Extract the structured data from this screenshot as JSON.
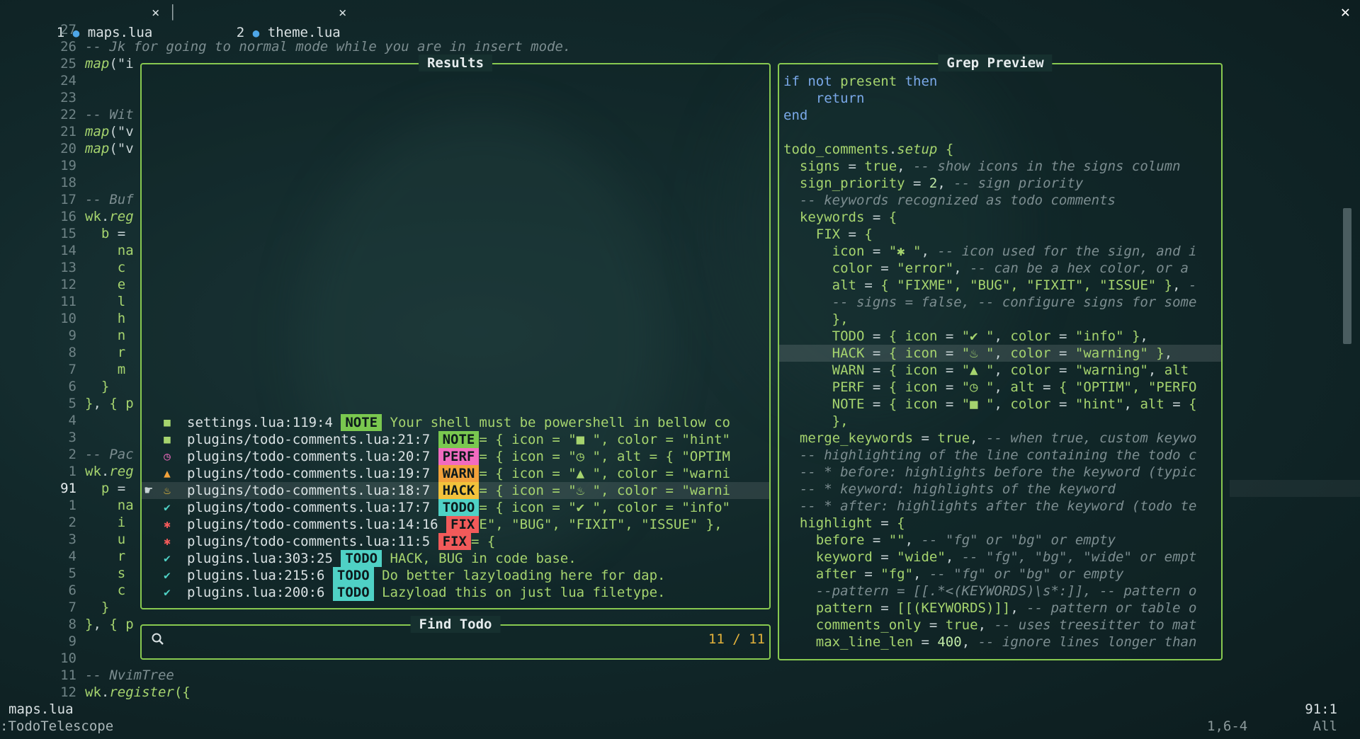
{
  "tabs": [
    {
      "index": "1",
      "name": "maps.lua",
      "close": "×"
    },
    {
      "index": "2",
      "name": "theme.lua",
      "close": "×"
    }
  ],
  "window_close": "✕",
  "editor": {
    "lines": [
      {
        "n": "27",
        "parts": []
      },
      {
        "n": "26",
        "parts": [
          [
            "cm",
            "-- Jk for going to normal mode while you are in insert mode."
          ]
        ]
      },
      {
        "n": "25",
        "parts": [
          [
            "fn",
            "map"
          ],
          [
            "op",
            "(\"i"
          ]
        ]
      },
      {
        "n": "24",
        "parts": []
      },
      {
        "n": "23",
        "parts": []
      },
      {
        "n": "22",
        "parts": [
          [
            "cm",
            "-- Wit"
          ]
        ]
      },
      {
        "n": "21",
        "parts": [
          [
            "fn",
            "map"
          ],
          [
            "op",
            "(\"v"
          ]
        ]
      },
      {
        "n": "20",
        "parts": [
          [
            "fn",
            "map"
          ],
          [
            "op",
            "(\"v"
          ]
        ]
      },
      {
        "n": "19",
        "parts": []
      },
      {
        "n": "18",
        "parts": []
      },
      {
        "n": "17",
        "parts": [
          [
            "cm",
            "-- Buf"
          ]
        ]
      },
      {
        "n": "16",
        "parts": [
          [
            "var",
            "wk"
          ],
          [
            "op",
            "."
          ],
          [
            "fn",
            "reg"
          ]
        ]
      },
      {
        "n": "15",
        "parts": [
          [
            "var",
            "  b "
          ],
          [
            "op",
            "="
          ]
        ]
      },
      {
        "n": "14",
        "parts": [
          [
            "var",
            "    na"
          ]
        ]
      },
      {
        "n": "13",
        "parts": [
          [
            "var",
            "    c"
          ]
        ]
      },
      {
        "n": "12",
        "parts": [
          [
            "var",
            "    e"
          ]
        ]
      },
      {
        "n": "11",
        "parts": [
          [
            "var",
            "    l"
          ]
        ]
      },
      {
        "n": "10",
        "parts": [
          [
            "var",
            "    h"
          ]
        ]
      },
      {
        "n": "9",
        "parts": [
          [
            "var",
            "    n"
          ]
        ]
      },
      {
        "n": "8",
        "parts": [
          [
            "var",
            "    r"
          ]
        ]
      },
      {
        "n": "7",
        "parts": [
          [
            "var",
            "    m"
          ]
        ]
      },
      {
        "n": "6",
        "parts": [
          [
            "str",
            "  }"
          ]
        ]
      },
      {
        "n": "5",
        "parts": [
          [
            "str",
            "}"
          ],
          [
            "op",
            ", "
          ],
          [
            "str",
            "{ p"
          ]
        ]
      },
      {
        "n": "4",
        "parts": []
      },
      {
        "n": "3",
        "parts": []
      },
      {
        "n": "2",
        "parts": [
          [
            "cm",
            "-- Pac"
          ]
        ]
      },
      {
        "n": "1",
        "parts": [
          [
            "var",
            "wk"
          ],
          [
            "op",
            "."
          ],
          [
            "fn",
            "reg"
          ]
        ]
      },
      {
        "n": "91",
        "cur": true,
        "parts": [
          [
            "var",
            "  p "
          ],
          [
            "op",
            "="
          ]
        ]
      },
      {
        "n": "1",
        "parts": [
          [
            "var",
            "    na"
          ]
        ]
      },
      {
        "n": "2",
        "parts": [
          [
            "var",
            "    i"
          ]
        ]
      },
      {
        "n": "3",
        "parts": [
          [
            "var",
            "    u"
          ]
        ]
      },
      {
        "n": "4",
        "parts": [
          [
            "var",
            "    r"
          ]
        ]
      },
      {
        "n": "5",
        "parts": [
          [
            "var",
            "    s"
          ]
        ]
      },
      {
        "n": "6",
        "parts": [
          [
            "var",
            "    c"
          ]
        ]
      },
      {
        "n": "7",
        "parts": [
          [
            "str",
            "  }"
          ]
        ]
      },
      {
        "n": "8",
        "parts": [
          [
            "str",
            "}"
          ],
          [
            "op",
            ", "
          ],
          [
            "str",
            "{ p"
          ]
        ]
      },
      {
        "n": "9",
        "parts": []
      },
      {
        "n": "10",
        "parts": []
      },
      {
        "n": "11",
        "parts": [
          [
            "cm",
            "-- NvimTree"
          ]
        ]
      },
      {
        "n": "12",
        "parts": [
          [
            "var",
            "wk"
          ],
          [
            "op",
            "."
          ],
          [
            "fn",
            "register"
          ],
          [
            "str",
            "({"
          ]
        ]
      }
    ]
  },
  "results": {
    "title": "Results",
    "items": [
      {
        "icon": "■",
        "icon_color": "#a6d46e",
        "path": "settings.lua:119:4 ",
        "tag": "NOTE",
        "tag_color": "#7ac84f",
        "text": " Your shell must be powershell in bellow co"
      },
      {
        "icon": "■",
        "icon_color": "#a6d46e",
        "path": "plugins/todo-comments.lua:21:7 ",
        "tag": "NOTE",
        "tag_color": "#7ac84f",
        "text": "= { icon = \"■ \", color = \"hint\""
      },
      {
        "icon": "◷",
        "icon_color": "#f26bc0",
        "path": "plugins/todo-comments.lua:20:7 ",
        "tag": "PERF",
        "tag_color": "#f26bc0",
        "text": "= { icon = \"◷ \", alt = { \"OPTIM"
      },
      {
        "icon": "▲",
        "icon_color": "#f2a23b",
        "path": "plugins/todo-comments.lua:19:7 ",
        "tag": "WARN",
        "tag_color": "#f2a23b",
        "text": "= { icon = \"▲ \", color = \"warni"
      },
      {
        "icon": "♨",
        "icon_color": "#f2c23b",
        "path": "plugins/todo-comments.lua:18:7 ",
        "tag": "HACK",
        "tag_color": "#f2c23b",
        "text": "= { icon = \"♨ \", color = \"warni",
        "selected": true,
        "marker": "☛"
      },
      {
        "icon": "✔",
        "icon_color": "#4fd1c5",
        "path": "plugins/todo-comments.lua:17:7 ",
        "tag": "TODO",
        "tag_color": "#4fd1c5",
        "text": "= { icon = \"✔ \", color = \"info\""
      },
      {
        "icon": "✱",
        "icon_color": "#f25a5a",
        "path": "plugins/todo-comments.lua:14:16 ",
        "tag": "FIX",
        "tag_color": "#f25a5a",
        "text": "E\", \"BUG\", \"FIXIT\", \"ISSUE\" },"
      },
      {
        "icon": "✱",
        "icon_color": "#f25a5a",
        "path": "plugins/todo-comments.lua:11:5 ",
        "tag": "FIX",
        "tag_color": "#f25a5a",
        "text": "= {"
      },
      {
        "icon": "✔",
        "icon_color": "#4fd1c5",
        "path": "plugins.lua:303:25 ",
        "tag": "TODO",
        "tag_color": "#4fd1c5",
        "text": " HACK, BUG in code base."
      },
      {
        "icon": "✔",
        "icon_color": "#4fd1c5",
        "path": "plugins.lua:215:6 ",
        "tag": "TODO",
        "tag_color": "#4fd1c5",
        "text": " Do better lazyloading here for dap."
      },
      {
        "icon": "✔",
        "icon_color": "#4fd1c5",
        "path": "plugins.lua:200:6 ",
        "tag": "TODO",
        "tag_color": "#4fd1c5",
        "text": " Lazyload this on just lua filetype."
      }
    ]
  },
  "preview": {
    "title": "Grep Preview",
    "lines": [
      {
        "parts": [
          [
            "kw",
            "if not "
          ],
          [
            "var",
            "present"
          ],
          [
            "kw",
            " then"
          ]
        ]
      },
      {
        "parts": [
          [
            "kw",
            "    return"
          ]
        ]
      },
      {
        "parts": [
          [
            "kw",
            "end"
          ]
        ]
      },
      {
        "parts": []
      },
      {
        "parts": [
          [
            "var",
            "todo_comments"
          ],
          [
            "op",
            "."
          ],
          [
            "fn",
            "setup"
          ],
          [
            "str",
            " {"
          ]
        ]
      },
      {
        "parts": [
          [
            "var",
            "  signs "
          ],
          [
            "op",
            "= "
          ],
          [
            "t-true",
            "true"
          ],
          [
            "op",
            ", "
          ],
          [
            "cm",
            "-- show icons in the signs column"
          ]
        ]
      },
      {
        "parts": [
          [
            "var",
            "  sign_priority "
          ],
          [
            "op",
            "= "
          ],
          [
            "num-lit",
            "2"
          ],
          [
            "op",
            ", "
          ],
          [
            "cm",
            "-- sign priority"
          ]
        ]
      },
      {
        "parts": [
          [
            "cm",
            "  -- keywords recognized as todo comments"
          ]
        ]
      },
      {
        "parts": [
          [
            "var",
            "  keywords "
          ],
          [
            "op",
            "= "
          ],
          [
            "str",
            "{"
          ]
        ]
      },
      {
        "parts": [
          [
            "var",
            "    FIX "
          ],
          [
            "op",
            "= "
          ],
          [
            "str",
            "{"
          ]
        ]
      },
      {
        "parts": [
          [
            "var",
            "      icon "
          ],
          [
            "op",
            "= "
          ],
          [
            "str",
            "\"✱ \""
          ],
          [
            "op",
            ", "
          ],
          [
            "cm",
            "-- icon used for the sign, and i"
          ]
        ]
      },
      {
        "parts": [
          [
            "var",
            "      color "
          ],
          [
            "op",
            "= "
          ],
          [
            "str",
            "\"error\""
          ],
          [
            "op",
            ", "
          ],
          [
            "cm",
            "-- can be a hex color, or a"
          ]
        ]
      },
      {
        "parts": [
          [
            "var",
            "      alt "
          ],
          [
            "op",
            "= "
          ],
          [
            "str",
            "{ \"FIXME\", \"BUG\", \"FIXIT\", \"ISSUE\" }"
          ],
          [
            "op",
            ", "
          ],
          [
            "cm",
            "-"
          ]
        ]
      },
      {
        "parts": [
          [
            "cm",
            "      -- signs = false, -- configure signs for some"
          ]
        ]
      },
      {
        "parts": [
          [
            "str",
            "      },"
          ]
        ]
      },
      {
        "parts": [
          [
            "var",
            "      TODO "
          ],
          [
            "op",
            "= "
          ],
          [
            "str",
            "{ "
          ],
          [
            "var",
            "icon "
          ],
          [
            "op",
            "= "
          ],
          [
            "str",
            "\"✔ \""
          ],
          [
            "op",
            ", "
          ],
          [
            "var",
            "color "
          ],
          [
            "op",
            "= "
          ],
          [
            "str",
            "\"info\" }"
          ],
          [
            "op",
            ","
          ]
        ]
      },
      {
        "hl": true,
        "parts": [
          [
            "var",
            "      HACK "
          ],
          [
            "op",
            "= "
          ],
          [
            "str",
            "{ "
          ],
          [
            "var",
            "icon "
          ],
          [
            "op",
            "= "
          ],
          [
            "str",
            "\"♨ \""
          ],
          [
            "op",
            ", "
          ],
          [
            "var",
            "color "
          ],
          [
            "op",
            "= "
          ],
          [
            "str",
            "\"warning\" }"
          ],
          [
            "op",
            ","
          ]
        ]
      },
      {
        "parts": [
          [
            "var",
            "      WARN "
          ],
          [
            "op",
            "= "
          ],
          [
            "str",
            "{ "
          ],
          [
            "var",
            "icon "
          ],
          [
            "op",
            "= "
          ],
          [
            "str",
            "\"▲ \""
          ],
          [
            "op",
            ", "
          ],
          [
            "var",
            "color "
          ],
          [
            "op",
            "= "
          ],
          [
            "str",
            "\"warning\""
          ],
          [
            "op",
            ", "
          ],
          [
            "var",
            "alt"
          ]
        ]
      },
      {
        "parts": [
          [
            "var",
            "      PERF "
          ],
          [
            "op",
            "= "
          ],
          [
            "str",
            "{ "
          ],
          [
            "var",
            "icon "
          ],
          [
            "op",
            "= "
          ],
          [
            "str",
            "\"◷ \""
          ],
          [
            "op",
            ", "
          ],
          [
            "var",
            "alt "
          ],
          [
            "op",
            "= "
          ],
          [
            "str",
            "{ \"OPTIM\", \"PERFO"
          ]
        ]
      },
      {
        "parts": [
          [
            "var",
            "      NOTE "
          ],
          [
            "op",
            "= "
          ],
          [
            "str",
            "{ "
          ],
          [
            "var",
            "icon "
          ],
          [
            "op",
            "= "
          ],
          [
            "str",
            "\"■ \""
          ],
          [
            "op",
            ", "
          ],
          [
            "var",
            "color "
          ],
          [
            "op",
            "= "
          ],
          [
            "str",
            "\"hint\""
          ],
          [
            "op",
            ", "
          ],
          [
            "var",
            "alt "
          ],
          [
            "op",
            "= "
          ],
          [
            "str",
            "{"
          ]
        ]
      },
      {
        "parts": [
          [
            "str",
            "      },"
          ]
        ]
      },
      {
        "parts": [
          [
            "var",
            "  merge_keywords "
          ],
          [
            "op",
            "= "
          ],
          [
            "t-true",
            "true"
          ],
          [
            "op",
            ", "
          ],
          [
            "cm",
            "-- when true, custom keywo"
          ]
        ]
      },
      {
        "parts": [
          [
            "cm",
            "  -- highlighting of the line containing the todo c"
          ]
        ]
      },
      {
        "parts": [
          [
            "cm",
            "  -- * before: highlights before the keyword (typic"
          ]
        ]
      },
      {
        "parts": [
          [
            "cm",
            "  -- * keyword: highlights of the keyword"
          ]
        ]
      },
      {
        "parts": [
          [
            "cm",
            "  -- * after: highlights after the keyword (todo te"
          ]
        ]
      },
      {
        "parts": [
          [
            "var",
            "  highlight "
          ],
          [
            "op",
            "= "
          ],
          [
            "str",
            "{"
          ]
        ]
      },
      {
        "parts": [
          [
            "var",
            "    before "
          ],
          [
            "op",
            "= "
          ],
          [
            "str",
            "\"\""
          ],
          [
            "op",
            ", "
          ],
          [
            "cm",
            "-- \"fg\" or \"bg\" or empty"
          ]
        ]
      },
      {
        "parts": [
          [
            "var",
            "    keyword "
          ],
          [
            "op",
            "= "
          ],
          [
            "str",
            "\"wide\""
          ],
          [
            "op",
            ", "
          ],
          [
            "cm",
            "-- \"fg\", \"bg\", \"wide\" or empt"
          ]
        ]
      },
      {
        "parts": [
          [
            "var",
            "    after "
          ],
          [
            "op",
            "= "
          ],
          [
            "str",
            "\"fg\""
          ],
          [
            "op",
            ", "
          ],
          [
            "cm",
            "-- \"fg\" or \"bg\" or empty"
          ]
        ]
      },
      {
        "parts": [
          [
            "cm",
            "    --pattern = [[.*<(KEYWORDS)\\s*:]], -- pattern o"
          ]
        ]
      },
      {
        "parts": [
          [
            "var",
            "    pattern "
          ],
          [
            "op",
            "= "
          ],
          [
            "str",
            "[[(KEYWORDS)]]"
          ],
          [
            "op",
            ", "
          ],
          [
            "cm",
            "-- pattern or table o"
          ]
        ]
      },
      {
        "parts": [
          [
            "var",
            "    comments_only "
          ],
          [
            "op",
            "= "
          ],
          [
            "t-true",
            "true"
          ],
          [
            "op",
            ", "
          ],
          [
            "cm",
            "-- uses treesitter to mat"
          ]
        ]
      },
      {
        "parts": [
          [
            "var",
            "    max_line_len "
          ],
          [
            "op",
            "= "
          ],
          [
            "num-lit",
            "400"
          ],
          [
            "op",
            ", "
          ],
          [
            "cm",
            "-- ignore lines longer than"
          ]
        ]
      }
    ]
  },
  "find": {
    "title": "Find Todo",
    "query": "",
    "counter": "11 / 11"
  },
  "status": {
    "filename": "maps.lua",
    "position": "91:1",
    "command": ":TodoTelescope",
    "ruler": "1,6-4",
    "scroll": "All"
  }
}
